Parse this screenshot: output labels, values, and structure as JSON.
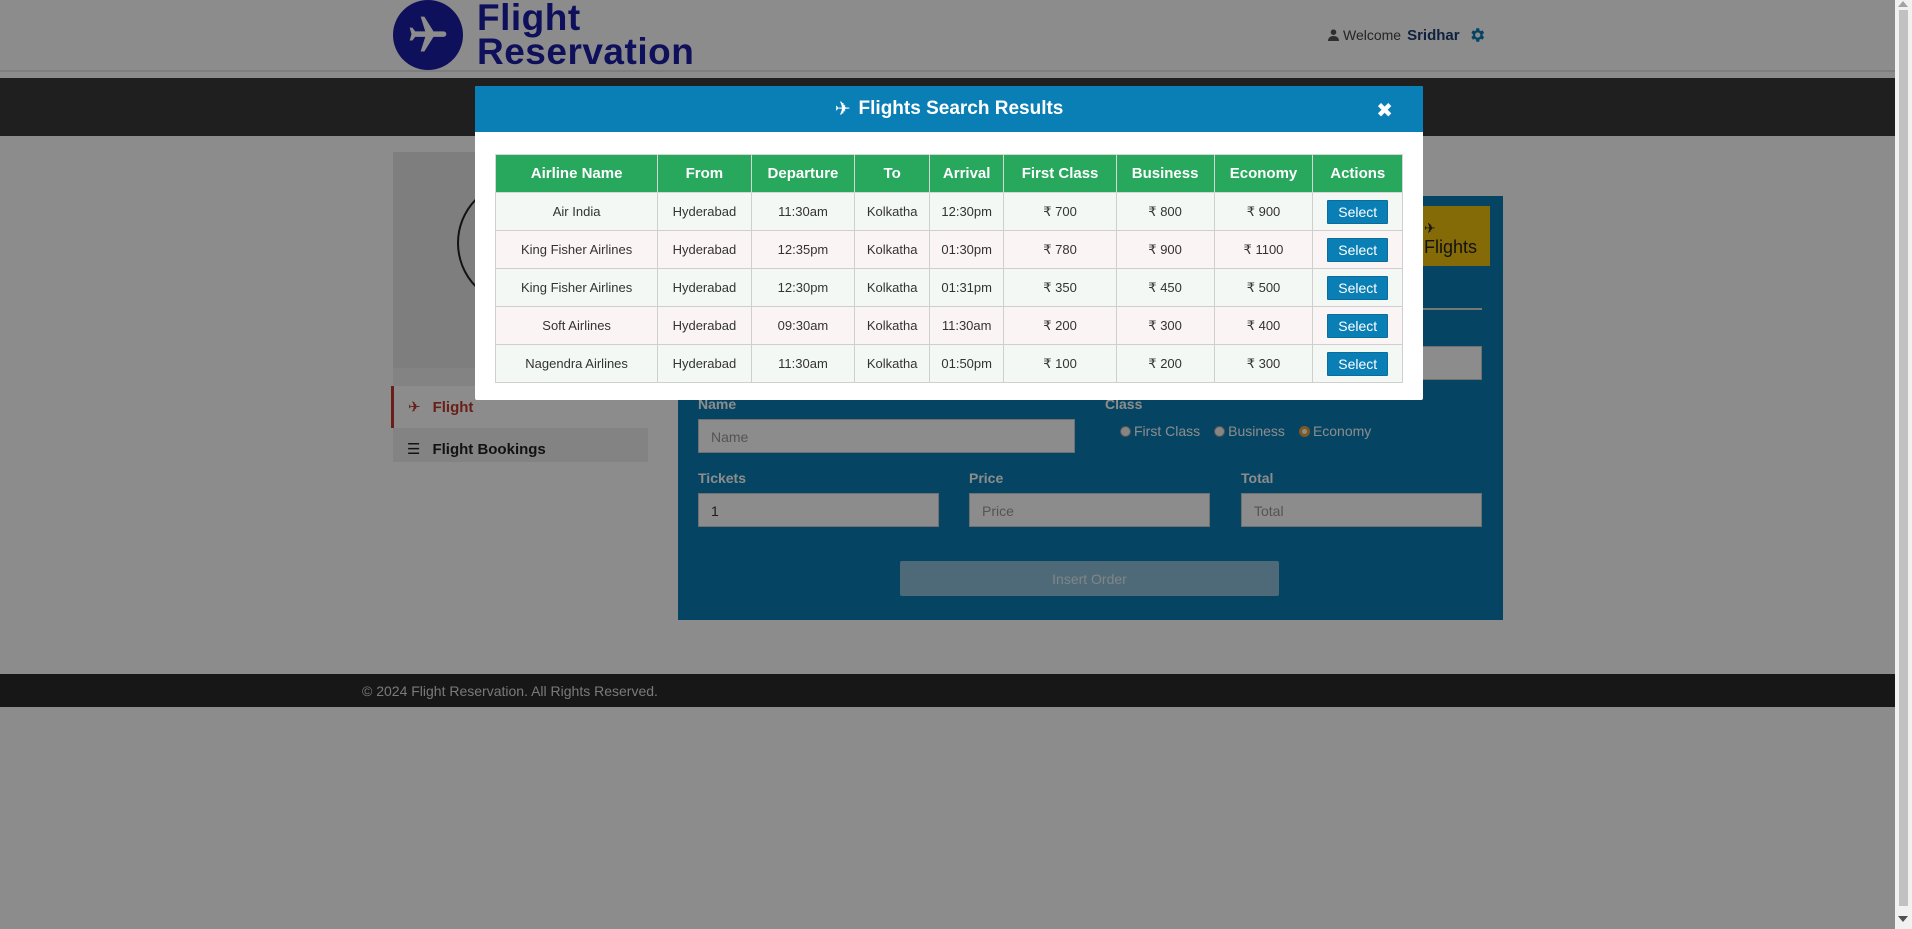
{
  "header": {
    "logo_line1": "Flight",
    "logo_line2": "Reservation",
    "welcome_label": "Welcome",
    "user_name": "Sridhar"
  },
  "sidebar": {
    "items": [
      {
        "label": "Flight"
      },
      {
        "label": "Flight Bookings"
      }
    ]
  },
  "form": {
    "flights_button_label": "Flights",
    "name_label": "Name",
    "name_placeholder": "Name",
    "class_label": "Class",
    "class_options": [
      "First Class",
      "Business",
      "Economy"
    ],
    "class_selected": "Economy",
    "tickets_label": "Tickets",
    "tickets_value": "1",
    "price_label": "Price",
    "price_placeholder": "Price",
    "total_label": "Total",
    "total_placeholder": "Total",
    "insert_button_label": "Insert Order"
  },
  "footer": {
    "text": "© 2024 Flight Reservation. All Rights Reserved."
  },
  "modal": {
    "title": "Flights Search Results",
    "close_symbol": "✖",
    "currency_symbol": "₹",
    "columns": [
      "Airline Name",
      "From",
      "Departure",
      "To",
      "Arrival",
      "First Class",
      "Business",
      "Economy",
      "Actions"
    ],
    "select_label": "Select",
    "rows": [
      {
        "airline": "Air India",
        "from": "Hyderabad",
        "departure": "11:30am",
        "to": "Kolkatha",
        "arrival": "12:30pm",
        "first": "700",
        "business": "800",
        "economy": "900"
      },
      {
        "airline": "King Fisher Airlines",
        "from": "Hyderabad",
        "departure": "12:35pm",
        "to": "Kolkatha",
        "arrival": "01:30pm",
        "first": "780",
        "business": "900",
        "economy": "1100"
      },
      {
        "airline": "King Fisher Airlines",
        "from": "Hyderabad",
        "departure": "12:30pm",
        "to": "Kolkatha",
        "arrival": "01:31pm",
        "first": "350",
        "business": "450",
        "economy": "500"
      },
      {
        "airline": "Soft Airlines",
        "from": "Hyderabad",
        "departure": "09:30am",
        "to": "Kolkatha",
        "arrival": "11:30am",
        "first": "200",
        "business": "300",
        "economy": "400"
      },
      {
        "airline": "Nagendra Airlines",
        "from": "Hyderabad",
        "departure": "11:30am",
        "to": "Kolkatha",
        "arrival": "01:50pm",
        "first": "100",
        "business": "200",
        "economy": "300"
      }
    ]
  },
  "colors": {
    "brand_blue": "#1d1ea8",
    "panel_blue": "#0a7fb5",
    "table_header_green": "#27a85c",
    "accent_yellow": "#f1c40f",
    "active_red": "#c0392b"
  }
}
